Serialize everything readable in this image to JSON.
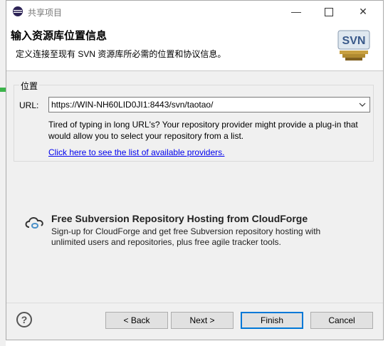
{
  "window": {
    "title": "共享项目"
  },
  "header": {
    "title": "输入资源库位置信息",
    "description": "定义连接至现有 SVN 资源库所必需的位置和协议信息。",
    "logo_text": "SVN"
  },
  "location_group": {
    "legend": "位置",
    "url_label": "URL:",
    "url_value": "https://WIN-NH60LID0JI1:8443/svn/taotao/",
    "hint": "Tired of typing in long URL's?  Your repository provider might provide a plug-in that would allow you to select your repository from a list.",
    "providers_link": "Click here to see the list of available providers."
  },
  "cloudforge": {
    "title": "Free Subversion Repository Hosting from CloudForge",
    "description": "Sign-up for CloudForge and get free Subversion repository hosting with unlimited users and repositories, plus free agile tracker tools."
  },
  "buttons": {
    "back": "< Back",
    "next": "Next >",
    "finish": "Finish",
    "cancel": "Cancel"
  },
  "colors": {
    "accent": "#0078d7",
    "link": "#0000ee",
    "dialog_bg": "#f0f0f0"
  }
}
